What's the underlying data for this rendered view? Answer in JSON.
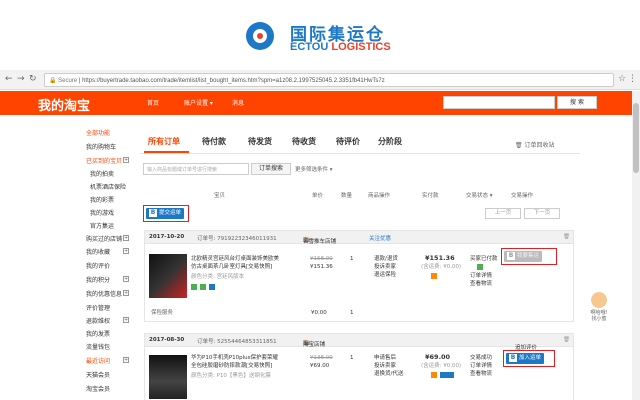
{
  "banner": {
    "name_cn": "国际集运仓",
    "name_en_1": "ECTOU",
    "name_en_2": "LOGISTICS"
  },
  "browser": {
    "secure_label": "Secure",
    "url": "https://buyertrade.taobao.com/trade/itemlist/list_bought_items.htm?spm=a1z08.2.1997525045.2.3351fb41HwTs7z"
  },
  "header": {
    "brand": "我的淘宝",
    "nav": [
      "首页",
      "账户设置 ▾",
      "消息"
    ],
    "search_button": "搜 索"
  },
  "sidebar": {
    "items": [
      {
        "label": "全部功能",
        "red": true
      },
      {
        "label": "我的购物车",
        "red": false
      },
      {
        "label": "已买到的宝贝",
        "red": true
      },
      {
        "label": "我的拍卖",
        "red": false
      },
      {
        "label": "机票酒店保险",
        "red": false
      },
      {
        "label": "我的彩票",
        "red": false
      },
      {
        "label": "我的游戏",
        "red": false
      },
      {
        "label": "官方集运",
        "red": false
      },
      {
        "label": "购买过的店铺",
        "red": false
      },
      {
        "label": "我的收藏",
        "red": false
      },
      {
        "label": "我的评价",
        "red": false
      },
      {
        "label": "我的积分",
        "red": false
      },
      {
        "label": "我的优惠信息",
        "red": false
      },
      {
        "label": "评价管理",
        "red": false
      },
      {
        "label": "退款维权",
        "red": false
      },
      {
        "label": "我的发票",
        "red": false
      },
      {
        "label": "流量钱包",
        "red": false
      },
      {
        "label": "最近访问",
        "red": true
      },
      {
        "label": "天猫会员",
        "red": false
      },
      {
        "label": "淘宝会员",
        "red": false
      }
    ]
  },
  "tabs": [
    "所有订单",
    "待付款",
    "待发货",
    "待收货",
    "待评价",
    "分阶段"
  ],
  "recycle_label": "订单回收站",
  "search": {
    "placeholder": "输入商品标题或订单号进行搜索",
    "button": "订单搜索",
    "more": "更多筛选条件 ▾"
  },
  "columns": [
    "宝贝",
    "单价",
    "数量",
    "商品操作",
    "实付款",
    "交易状态 ▾",
    "交易操作"
  ],
  "pager": {
    "prev": "上一页",
    "next": "下一页"
  },
  "ext_labels": {
    "top": "提交运单",
    "order1": "我要集运",
    "order2": "加入运单"
  },
  "orders": [
    {
      "date": "2017-10-20",
      "order_no": "订单号: 79192232346011931",
      "shop": "名雪推车店铺",
      "badge": "关注优惠",
      "title_line1": "北欧精灵宫廷风台灯桌面装饰美欧美",
      "title_line2": "仿古桌面茶几卧室灯具[交易快照]",
      "title_line3": "颜色分类: 宫廷风版本",
      "orig_price": "¥168.00",
      "price": "¥151.36",
      "qty": "1",
      "ops": [
        "退款/退货",
        "投诉卖家",
        "退运保险"
      ],
      "paid": "¥151.36",
      "paid_note": "(含运费: ¥0.00)",
      "status": [
        "买家已付款",
        "订单详情",
        "查看物流"
      ],
      "service_label": "保险服务",
      "service_price": "¥0.00",
      "service_qty": "1"
    },
    {
      "date": "2017-08-30",
      "order_no": "订单号: 52554464853311851",
      "shop": "淘宝店铺",
      "title_line1": "华为P10手机壳P10plus保护套荣耀",
      "title_line2": "全包硅胶磨砂防摔款潮[交易快照]",
      "title_line3": "颜色分类: P10【黑色】送钢化膜",
      "orig_price": "¥138.00",
      "price": "¥69.00",
      "qty": "1",
      "ops": [
        "申请售后",
        "投诉卖家",
        "退换货/代送"
      ],
      "paid": "¥69.00",
      "paid_note": "(含运费: ¥0.00)",
      "status": [
        "交易成功",
        "订单详情",
        "查看物流"
      ],
      "trade_op": "追加评价"
    }
  ],
  "assistant": {
    "line1": "啊哈哦!",
    "line2": "找小蜜"
  },
  "colors": {
    "accent": "#ff4400",
    "brand_blue": "#1e78c8",
    "highlight": "#e02020"
  }
}
